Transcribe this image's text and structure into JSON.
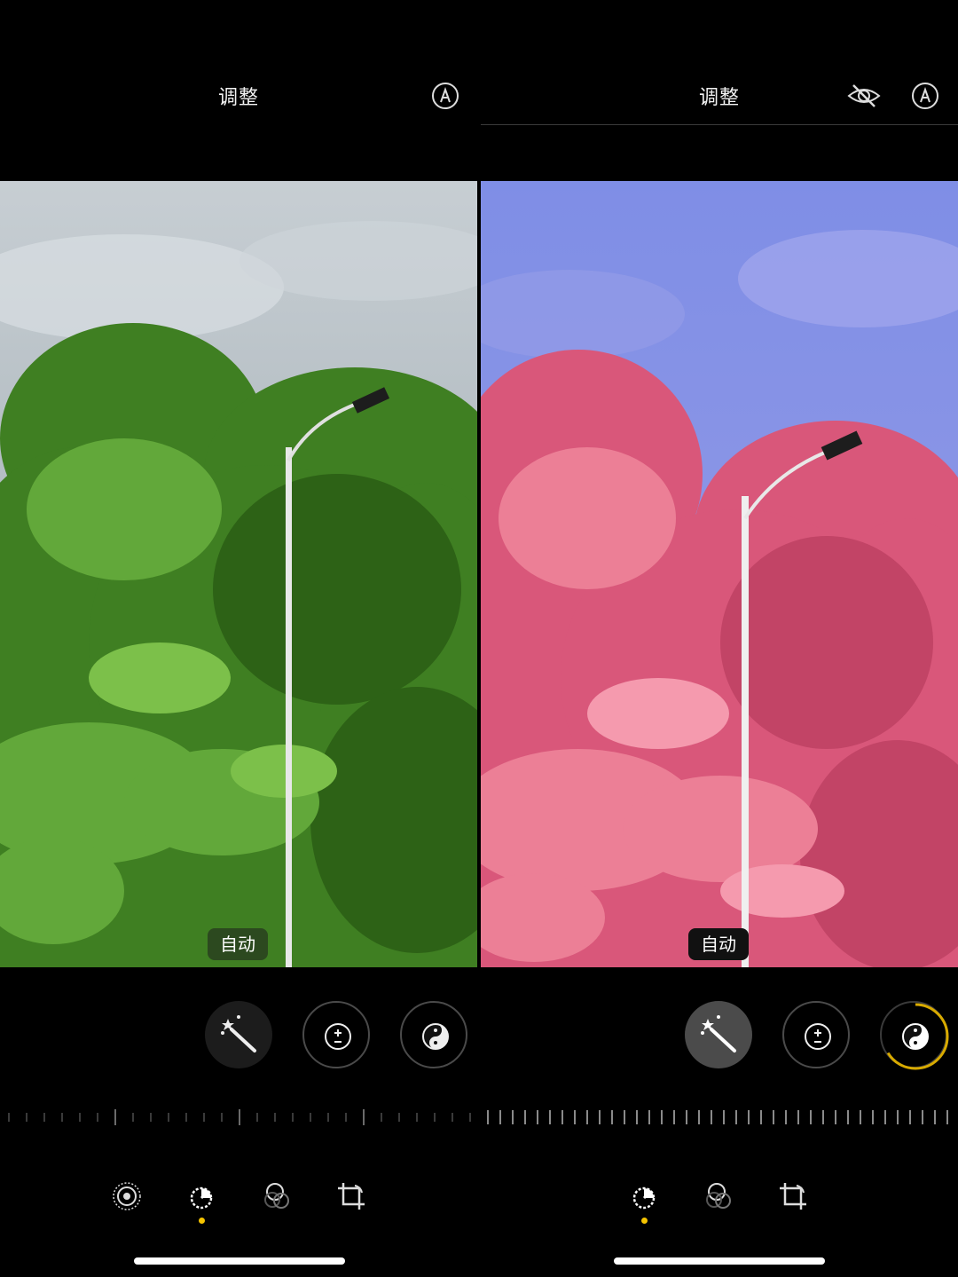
{
  "left": {
    "title": "调整",
    "auto_label": "自动",
    "photo": {
      "variant": "original",
      "sky": "#bcc6cc",
      "foliage": "#4e9a2a"
    }
  },
  "right": {
    "title": "调整",
    "auto_label": "自动",
    "photo": {
      "variant": "filtered",
      "sky": "#8a96e8",
      "foliage": "#e46d86"
    }
  },
  "tools": [
    "magic-wand-icon",
    "exposure-icon",
    "brilliance-icon"
  ],
  "bottom_nav": [
    "live-photo-icon",
    "adjust-icon",
    "filters-icon",
    "crop-icon"
  ],
  "colors": {
    "accent": "#f5c400",
    "background": "#000000"
  }
}
